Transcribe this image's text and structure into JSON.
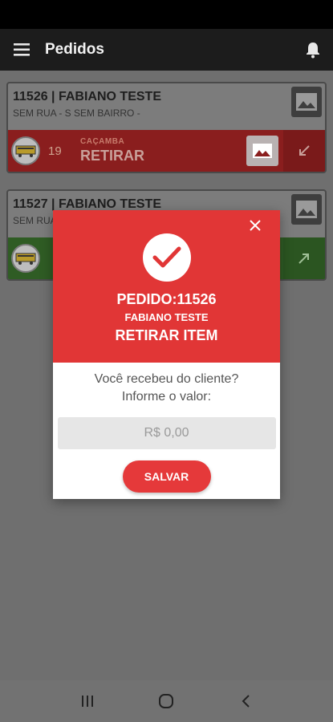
{
  "app_bar": {
    "title": "Pedidos",
    "menu_icon": "hamburger-menu-icon",
    "notification_icon": "bell-icon"
  },
  "orders": [
    {
      "title": "11526 | FABIANO TESTE",
      "address": "SEM RUA - S SEM BAIRRO -",
      "quantity": "19",
      "category": "CAÇAMBA",
      "action": "RETIRAR",
      "status_color": "#8a1e1e",
      "arrow_icon": "arrow-down-left-icon"
    },
    {
      "title": "11527 | FABIANO TESTE",
      "address": "SEM RUA",
      "quantity": "",
      "category": "",
      "action": "",
      "status_color": "#2f5c24",
      "arrow_icon": "arrow-up-right-icon"
    }
  ],
  "dialog": {
    "order_label": "PEDIDO:11526",
    "client_name": "FABIANO TESTE",
    "action_label": "RETIRAR ITEM",
    "prompt_line1": "Você recebeu do cliente?",
    "prompt_line2": "Informe o valor:",
    "value_placeholder": "R$ 0,00",
    "save_label": "SALVAR",
    "header_color": "#e13636",
    "button_color": "#e5393a"
  },
  "nav": {
    "recents_icon": "recent-apps-icon",
    "home_icon": "home-icon",
    "back_icon": "back-icon"
  }
}
